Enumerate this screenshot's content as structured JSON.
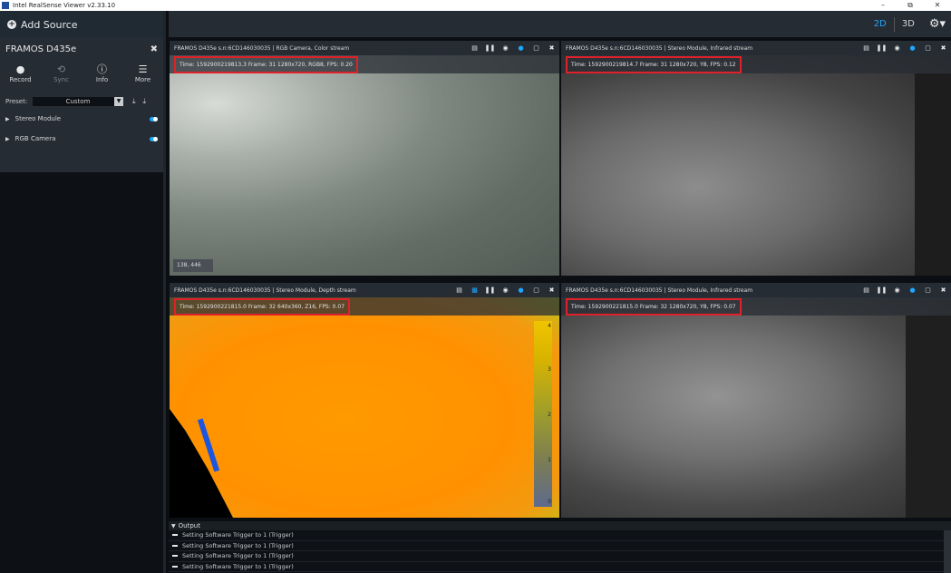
{
  "window": {
    "title": "Intel RealSense Viewer v2.33.10",
    "controls": [
      "–",
      "⧉",
      "✕"
    ]
  },
  "sidebar": {
    "add_source": "Add Source",
    "device": {
      "name": "FRAMOS D435e",
      "actions": [
        {
          "label": "Record",
          "icon": "record-icon",
          "glyph": "●"
        },
        {
          "label": "Sync",
          "icon": "sync-icon",
          "glyph": "⟲"
        },
        {
          "label": "Info",
          "icon": "info-icon",
          "glyph": "ⓘ"
        },
        {
          "label": "More",
          "icon": "menu-icon",
          "glyph": "☰"
        }
      ],
      "preset_label": "Preset:",
      "preset_value": "Custom",
      "sensors": [
        {
          "name": "Stereo Module",
          "state": "on"
        },
        {
          "name": "RGB Camera",
          "state": "on"
        }
      ]
    }
  },
  "toolbar": {
    "mode_2d": "2D",
    "mode_3d": "3D",
    "active_mode": "2D"
  },
  "panes": [
    {
      "title": "FRAMOS D435e s.n:6CD146030035 | RGB Camera, Color stream",
      "info": "Time: 1592900219813.3   Frame: 31  1280x720,  RGB8,   FPS:  0.20",
      "cursor": "138, 446"
    },
    {
      "title": "FRAMOS D435e s.n:6CD146030035 | Stereo Module, Infrared stream",
      "info": "Time: 1592900219814.7    Frame: 31  1280x720,  Y8,   FPS:  0.12"
    },
    {
      "title": "FRAMOS D435e s.n:6CD146030035 | Stereo Module, Depth stream",
      "info": "Time: 1592900221815.0    Frame: 32  640x360,  Z16,  FPS:  0.07",
      "colorbar_ticks": [
        "4",
        "3",
        "2",
        "1",
        "0"
      ]
    },
    {
      "title": "FRAMOS D435e s.n:6CD146030035 | Stereo Module, Infrared stream",
      "info": "Time: 1592900221815.0    Frame: 32  1280x720,  Y8,   FPS:  0.07"
    }
  ],
  "output": {
    "label": "Output",
    "lines": [
      "Setting Software Trigger to 1 (Trigger)",
      "Setting Software Trigger to 1 (Trigger)",
      "Setting Software Trigger to 1 (Trigger)",
      "Setting Software Trigger to 1 (Trigger)"
    ]
  },
  "colors": {
    "accent": "#1ea7ff",
    "highlight_box": "#e0202a",
    "panel_bg": "#262c33"
  }
}
